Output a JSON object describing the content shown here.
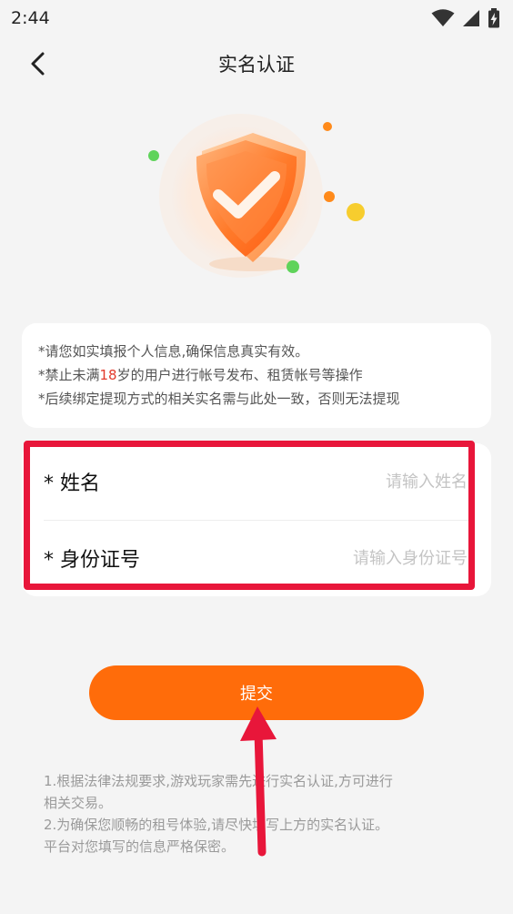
{
  "status_bar": {
    "time": "2:44"
  },
  "header": {
    "title": "实名认证"
  },
  "notice": {
    "line1": "*请您如实填报个人信息,确保信息真实有效。",
    "line2_prefix": "*禁止未满",
    "line2_age": "18",
    "line2_suffix": "岁的用户进行帐号发布、租赁帐号等操作",
    "line3": "*后续绑定提现方式的相关实名需与此处一致，否则无法提现"
  },
  "form": {
    "name_label": "* 姓名",
    "name_placeholder": "请输入姓名",
    "id_label": "* 身份证号",
    "id_placeholder": "请输入身份证号"
  },
  "submit_label": "提交",
  "footer": {
    "line1": "1.根据法律法规要求,游戏玩家需先进行实名认证,方可进行",
    "line2": "相关交易。",
    "line3": "2.为确保您顺畅的租号体验,请尽快填写上方的实名认证。",
    "line4": "平台对您填写的信息严格保密。"
  },
  "colors": {
    "accent": "#ff6c0a",
    "highlight_box": "#e8163a",
    "warning_number": "#e23a2c"
  },
  "icons": {
    "back": "chevron-left-icon",
    "wifi": "wifi-icon",
    "signal": "cell-signal-icon",
    "battery": "battery-charging-icon",
    "shield": "shield-check-icon"
  }
}
